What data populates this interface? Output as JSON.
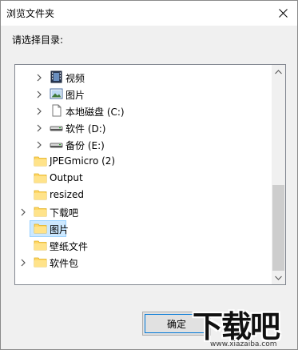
{
  "window": {
    "title": "浏览文件夹",
    "close_glyph": "✕"
  },
  "prompt": "请选择目录:",
  "tree": {
    "items": [
      {
        "label": "视频",
        "icon": "video-folder-icon",
        "expandable": true
      },
      {
        "label": "图片",
        "icon": "pictures-folder-icon",
        "expandable": true
      },
      {
        "label": "本地磁盘 (C:)",
        "icon": "drive-c-icon",
        "expandable": true
      },
      {
        "label": "软件 (D:)",
        "icon": "drive-icon",
        "expandable": true
      },
      {
        "label": "备份 (E:)",
        "icon": "drive-icon",
        "expandable": true
      },
      {
        "label": "JPEGmicro (2)",
        "icon": "folder-icon",
        "expandable": false
      },
      {
        "label": "Output",
        "icon": "folder-icon",
        "expandable": false
      },
      {
        "label": "resized",
        "icon": "folder-icon",
        "expandable": false
      },
      {
        "label": "下载吧",
        "icon": "folder-icon",
        "expandable": true
      },
      {
        "label": "图片",
        "icon": "folder-icon",
        "expandable": false,
        "selected": true
      },
      {
        "label": "壁纸文件",
        "icon": "folder-icon",
        "expandable": false
      },
      {
        "label": "软件包",
        "icon": "folder-icon",
        "expandable": true
      }
    ]
  },
  "buttons": {
    "ok": "确定"
  },
  "watermark": {
    "main": "下载吧",
    "sub": "www.xiazaiba.com"
  },
  "colors": {
    "selection_bg": "#cce8ff",
    "folder_yellow": "#ffd767",
    "focus_border": "#0078d7"
  }
}
